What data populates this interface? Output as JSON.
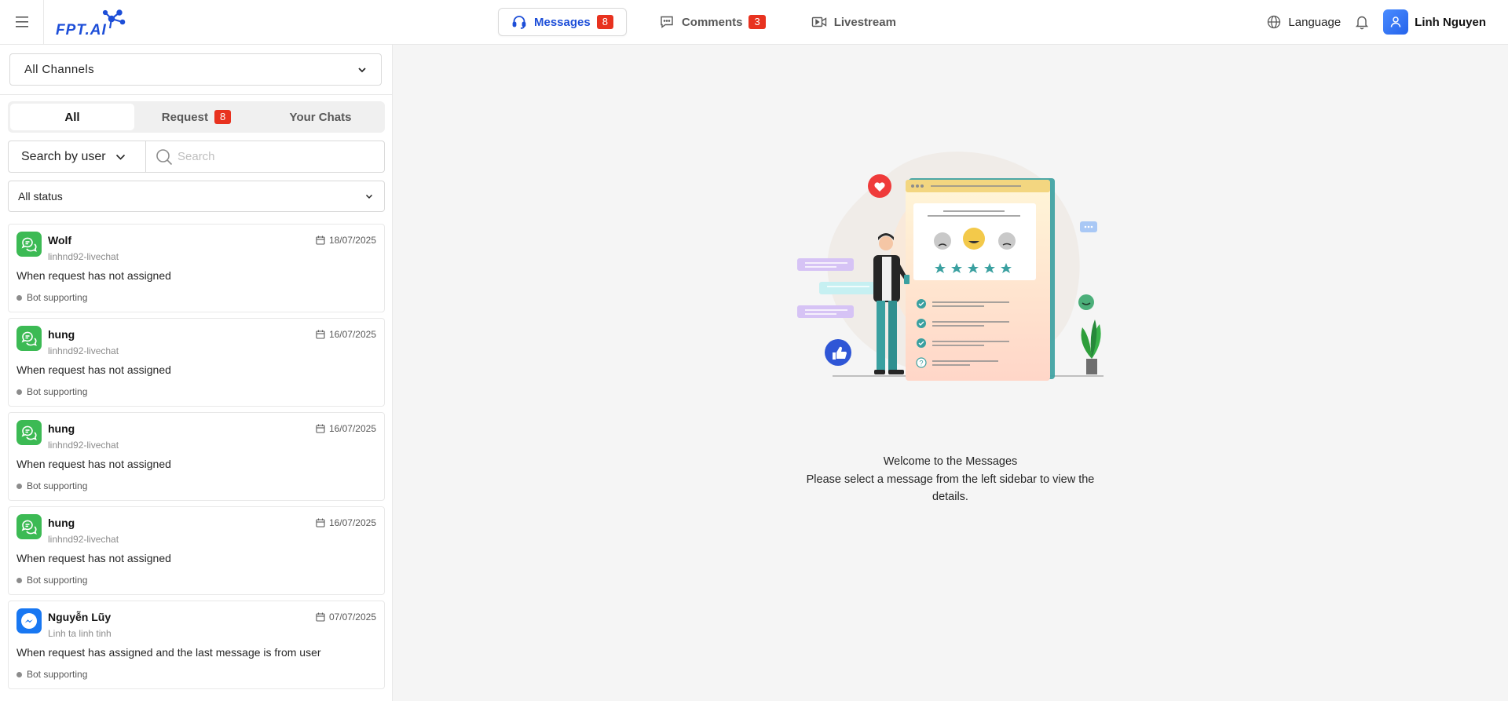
{
  "header": {
    "tabs": [
      {
        "label": "Messages",
        "badge": "8",
        "icon": "headset-icon",
        "active": true
      },
      {
        "label": "Comments",
        "badge": "3",
        "icon": "comment-icon"
      },
      {
        "label": "Livestream",
        "badge": "",
        "icon": "video-icon"
      }
    ],
    "language_label": "Language",
    "user_name": "Linh Nguyen",
    "logo_text": "FPT.AI"
  },
  "sidebar": {
    "channel_select": "All Channels",
    "segments": [
      {
        "label": "All",
        "active": true
      },
      {
        "label": "Request",
        "badge": "8"
      },
      {
        "label": "Your Chats"
      }
    ],
    "search_by": "Search by user",
    "search_placeholder": "Search",
    "status_select": "All status",
    "chats": [
      {
        "name": "Wolf",
        "source": "linhnd92-livechat",
        "date": "18/07/2025",
        "message": "When request has not assigned",
        "status": "Bot supporting",
        "channel": "livechat"
      },
      {
        "name": "hung",
        "source": "linhnd92-livechat",
        "date": "16/07/2025",
        "message": "When request has not assigned",
        "status": "Bot supporting",
        "channel": "livechat"
      },
      {
        "name": "hung",
        "source": "linhnd92-livechat",
        "date": "16/07/2025",
        "message": "When request has not assigned",
        "status": "Bot supporting",
        "channel": "livechat"
      },
      {
        "name": "hung",
        "source": "linhnd92-livechat",
        "date": "16/07/2025",
        "message": "When request has not assigned",
        "status": "Bot supporting",
        "channel": "livechat"
      },
      {
        "name": "Nguyễn Lũy",
        "source": "Linh ta linh tinh",
        "date": "07/07/2025",
        "message": "When request has assigned and the last message is from user",
        "status": "Bot supporting",
        "channel": "messenger"
      }
    ]
  },
  "main": {
    "welcome_line1": "Welcome to the Messages",
    "welcome_line2": "Please select a message from the left sidebar to view the details."
  },
  "colors": {
    "accent": "#1d4ed8",
    "badge": "#e8321f",
    "livechat": "#3cba54",
    "messenger": "#1877f2"
  }
}
